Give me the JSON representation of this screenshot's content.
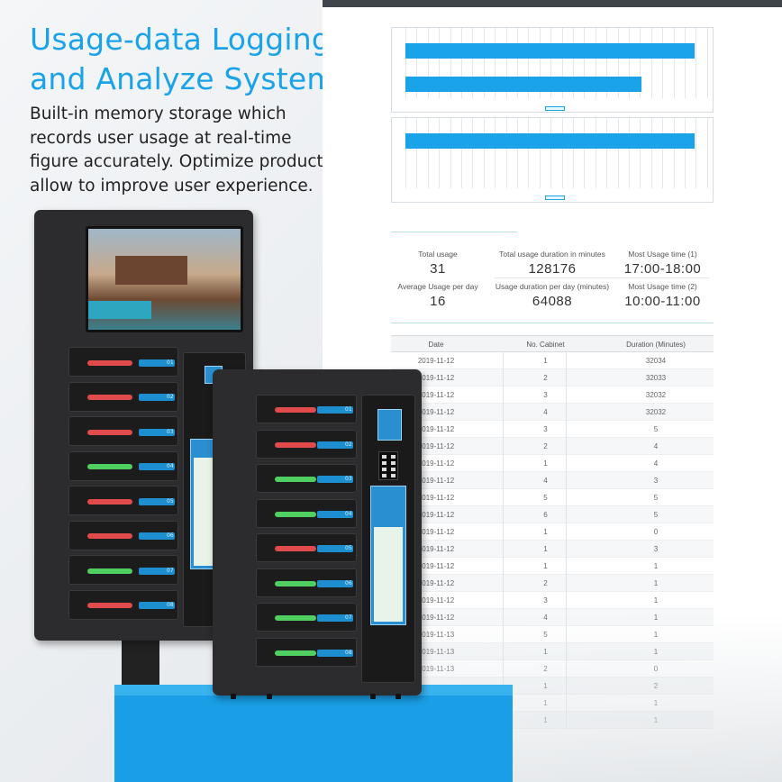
{
  "headline": {
    "title_line1": "Usage-data Logging",
    "title_line2": "and Analyze System",
    "description_line1": "Built-in memory storage which",
    "description_line2": "records user usage at real-time",
    "description_line3": "figure accurately. Optimize product",
    "description_line4": "allow to improve user experience."
  },
  "colors": {
    "accent": "#1aa3e8",
    "led_red": "#e24b4b",
    "led_green": "#4fcf5f",
    "pedestal": "#1a9ee6"
  },
  "stats": {
    "total_usage_label": "Total usage",
    "total_usage_value": "31",
    "total_duration_label": "Total usage duration in minutes",
    "total_duration_value": "128176",
    "most_time1_label": "Most Usage time (1)",
    "most_time1_value": "17:00-18:00",
    "avg_per_day_label": "Average Usage per day",
    "avg_per_day_value": "16",
    "duration_per_day_label": "Usage duration per day (minutes)",
    "duration_per_day_value": "64088",
    "most_time2_label": "Most Usage time (2)",
    "most_time2_value": "10:00-11:00"
  },
  "table": {
    "headers": [
      "Date",
      "No. Cabinet",
      "Duration (Minutes)"
    ],
    "rows": [
      [
        "2019-11-12",
        "1",
        "32034"
      ],
      [
        "2019-11-12",
        "2",
        "32033"
      ],
      [
        "2019-11-12",
        "3",
        "32032"
      ],
      [
        "2019-11-12",
        "4",
        "32032"
      ],
      [
        "2019-11-12",
        "3",
        "5"
      ],
      [
        "2019-11-12",
        "2",
        "4"
      ],
      [
        "2019-11-12",
        "1",
        "4"
      ],
      [
        "2019-11-12",
        "4",
        "3"
      ],
      [
        "2019-11-12",
        "5",
        "5"
      ],
      [
        "2019-11-12",
        "6",
        "5"
      ],
      [
        "2019-11-12",
        "1",
        "0"
      ],
      [
        "2019-11-12",
        "1",
        "3"
      ],
      [
        "2019-11-12",
        "1",
        "1"
      ],
      [
        "2019-11-12",
        "2",
        "1"
      ],
      [
        "2019-11-12",
        "3",
        "1"
      ],
      [
        "2019-11-12",
        "4",
        "1"
      ],
      [
        "2019-11-13",
        "5",
        "1"
      ],
      [
        "2019-11-13",
        "1",
        "1"
      ],
      [
        "2019-11-13",
        "2",
        "0"
      ],
      [
        "",
        "1",
        "2"
      ],
      [
        "",
        "1",
        "1"
      ],
      [
        "",
        "1",
        "1"
      ]
    ]
  },
  "charts": {
    "chart1_bars": [
      0.93,
      0.76
    ],
    "chart2_bars": [
      0.93
    ]
  },
  "kiosk_large": {
    "slots": [
      {
        "num": "01",
        "led": "red"
      },
      {
        "num": "02",
        "led": "red"
      },
      {
        "num": "03",
        "led": "red"
      },
      {
        "num": "04",
        "led": "green"
      },
      {
        "num": "05",
        "led": "red"
      },
      {
        "num": "06",
        "led": "red"
      },
      {
        "num": "07",
        "led": "green"
      },
      {
        "num": "08",
        "led": "red"
      }
    ]
  },
  "kiosk_small": {
    "slots": [
      {
        "num": "01",
        "led": "red"
      },
      {
        "num": "02",
        "led": "red"
      },
      {
        "num": "03",
        "led": "green"
      },
      {
        "num": "04",
        "led": "green"
      },
      {
        "num": "05",
        "led": "red"
      },
      {
        "num": "06",
        "led": "green"
      },
      {
        "num": "07",
        "led": "green"
      },
      {
        "num": "08",
        "led": "green"
      }
    ]
  }
}
